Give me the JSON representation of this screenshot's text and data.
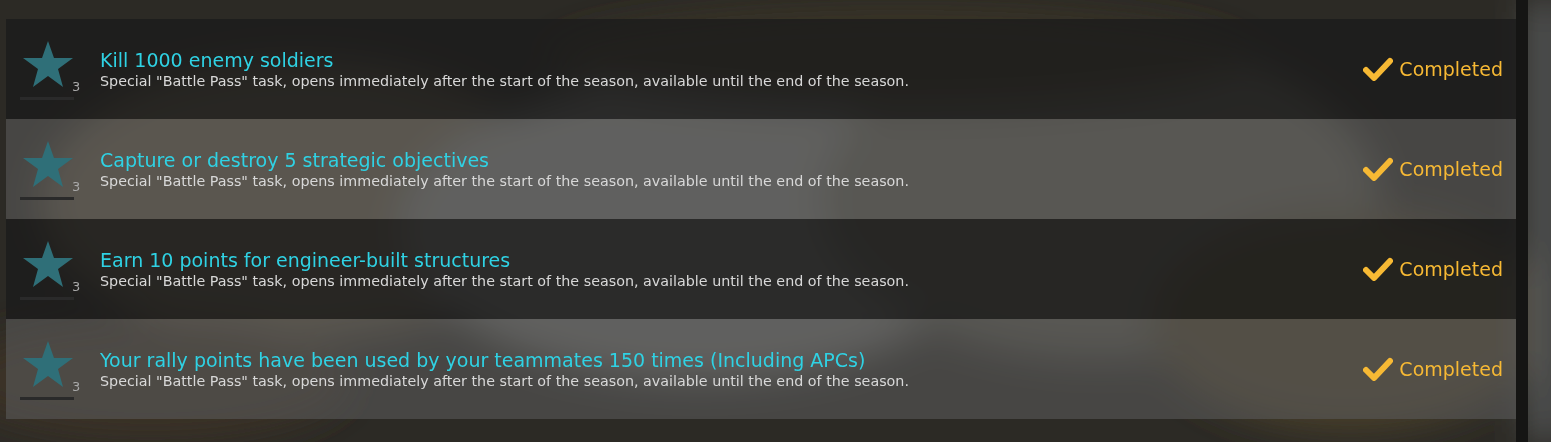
{
  "tasks": [
    {
      "title": "Kill 1000 enemy soldiers",
      "reward": "3",
      "description": "Special \"Battle Pass\" task, opens immediately after the start of the season, available until the end of the season.",
      "status": "Completed"
    },
    {
      "title": "Capture or destroy 5 strategic objectives",
      "reward": "3",
      "description": "Special \"Battle Pass\" task, opens immediately after the start of the season, available until the end of the season.",
      "status": "Completed"
    },
    {
      "title": "Earn 10 points for engineer-built structures",
      "reward": "3",
      "description": "Special \"Battle Pass\" task, opens immediately after the start of the season, available until the end of the season.",
      "status": "Completed"
    },
    {
      "title": "Your rally points have been used by your teammates 150 times (Including APCs)",
      "reward": "3",
      "description": "Special \"Battle Pass\" task, opens immediately after the start of the season, available until the end of the season.",
      "status": "Completed"
    }
  ]
}
